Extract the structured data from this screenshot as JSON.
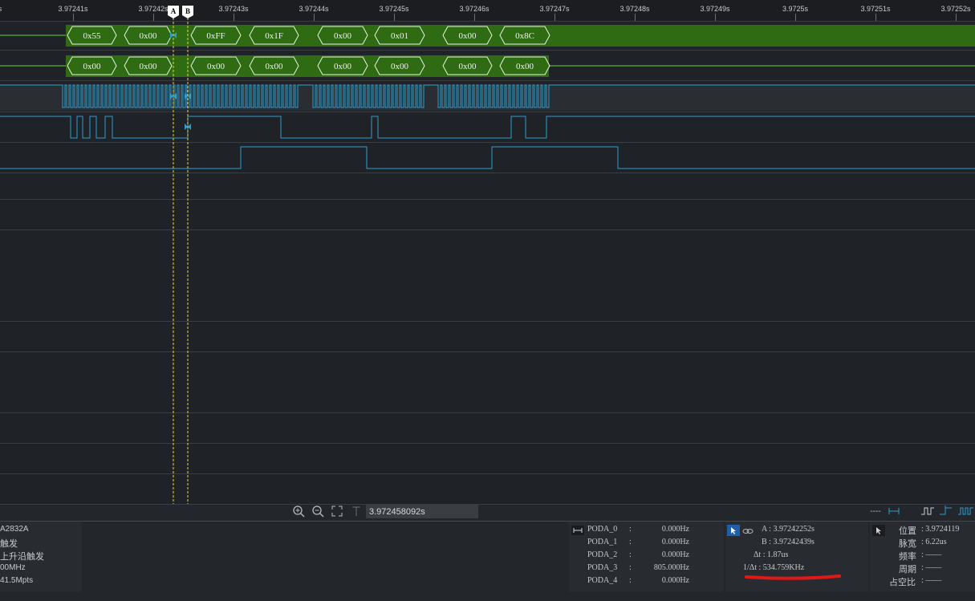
{
  "ruler": {
    "labels": [
      "3.97241s",
      "3.97242s",
      "3.97243s",
      "3.97244s",
      "3.97245s",
      "3.97246s",
      "3.97247s",
      "3.97248s",
      "3.97249s",
      "3.9725s",
      "3.97251s",
      "3.97252s"
    ]
  },
  "cursors": {
    "a_label": "A",
    "b_label": "B"
  },
  "channels": {
    "ch0_bytes": [
      "0x55",
      "0x00",
      "0xFF",
      "0x1F",
      "0x00",
      "0x01",
      "0x00",
      "0x8C"
    ],
    "ch1_bytes": [
      "0x00",
      "0x00",
      "0x00",
      "0x00",
      "0x00",
      "0x00",
      "0x00",
      "0x00"
    ]
  },
  "toolbar": {
    "time_value": "3.972458092s",
    "zoom_in_icon": "zoom-in-icon",
    "zoom_out_icon": "zoom-out-icon",
    "fit_icon": "fit-screen-icon",
    "marker_icon": "marker-icon",
    "right_dashes": "----"
  },
  "device": {
    "lines": [
      "A2832A",
      "触发",
      "上升沿触发",
      "00MHz",
      "41.5Mpts"
    ]
  },
  "freq": {
    "rows": [
      {
        "name": "PODA_0",
        "sep": ":",
        "value": "0.000Hz"
      },
      {
        "name": "PODA_1",
        "sep": ":",
        "value": "0.000Hz"
      },
      {
        "name": "PODA_2",
        "sep": ":",
        "value": "0.000Hz"
      },
      {
        "name": "PODA_3",
        "sep": ":",
        "value": "805.000Hz"
      },
      {
        "name": "PODA_4",
        "sep": ":",
        "value": "0.000Hz"
      }
    ]
  },
  "cursor_panel": {
    "a": "A : 3.97242252s",
    "b": "B : 3.97242439s",
    "dt": "Δt : 1.87us",
    "inv_dt": "1/Δt : 534.759KHz"
  },
  "measure": {
    "position_label": "位置",
    "position_value": ": 3.9724119",
    "width_label": "脉宽",
    "width_value": ": 6.22us",
    "freq_label": "频率",
    "freq_value": ": ——",
    "period_label": "周期",
    "period_value": ": ——",
    "duty_label": "占空比",
    "duty_value": ": ——"
  },
  "colors": {
    "bus_fill": "#2e6b12",
    "bus_line": "#66d639",
    "digital": "#2c9fd0",
    "cursor": "#e6d84a",
    "underline": "#e01818"
  }
}
